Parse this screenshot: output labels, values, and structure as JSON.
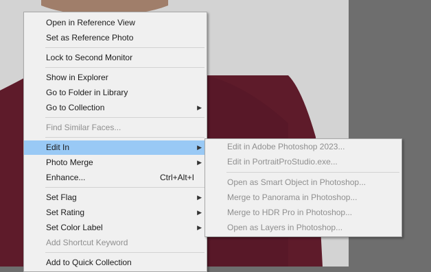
{
  "main_menu": {
    "items": [
      {
        "label": "Open in Reference View"
      },
      {
        "label": "Set as Reference Photo"
      },
      {
        "label": "Lock to Second Monitor"
      },
      {
        "label": "Show in Explorer"
      },
      {
        "label": "Go to Folder in Library"
      },
      {
        "label": "Go to Collection"
      },
      {
        "label": "Find Similar Faces..."
      },
      {
        "label": "Edit In"
      },
      {
        "label": "Photo Merge"
      },
      {
        "label": "Enhance...",
        "shortcut": "Ctrl+Alt+I"
      },
      {
        "label": "Set Flag"
      },
      {
        "label": "Set Rating"
      },
      {
        "label": "Set Color Label"
      },
      {
        "label": "Add Shortcut Keyword"
      },
      {
        "label": "Add to Quick Collection"
      }
    ]
  },
  "submenu": {
    "items": [
      {
        "label": "Edit in Adobe Photoshop 2023..."
      },
      {
        "label": "Edit in PortraitProStudio.exe..."
      },
      {
        "label": "Open as Smart Object in Photoshop..."
      },
      {
        "label": "Merge to Panorama in Photoshop..."
      },
      {
        "label": "Merge to HDR Pro in Photoshop..."
      },
      {
        "label": "Open as Layers in Photoshop..."
      }
    ]
  },
  "icons": {
    "submenu_arrow": "chevron-right-icon"
  },
  "colors": {
    "menu_background": "#f0f0f0",
    "highlight": "#99c9f5",
    "disabled_text": "#8f8f8f",
    "shirt": "#5e1b2a",
    "backdrop_wall": "#d3d3d3"
  }
}
